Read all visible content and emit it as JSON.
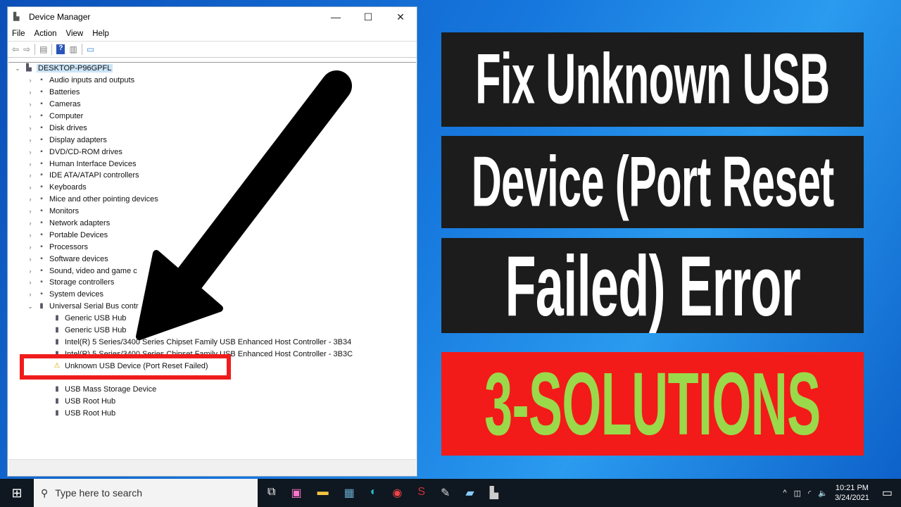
{
  "window": {
    "title": "Device Manager",
    "minimize": "—",
    "maximize": "☐",
    "close": "✕"
  },
  "menu": [
    "File",
    "Action",
    "View",
    "Help"
  ],
  "tree": {
    "root": "DESKTOP-P96GPFL",
    "categories": [
      "Audio inputs and outputs",
      "Batteries",
      "Cameras",
      "Computer",
      "Disk drives",
      "Display adapters",
      "DVD/CD-ROM drives",
      "Human Interface Devices",
      "IDE ATA/ATAPI controllers",
      "Keyboards",
      "Mice and other pointing devices",
      "Monitors",
      "Network adapters",
      "Portable Devices",
      "Processors",
      "Software devices",
      "Sound, video and game c",
      "Storage controllers",
      "System devices"
    ],
    "expanded": "Universal Serial Bus contr",
    "usb_children": [
      "Generic USB Hub",
      "Generic USB Hub",
      "Intel(R) 5 Series/3400 Series Chipset Family USB Enhanced Host Controller - 3B34",
      "Intel(R) 5 Series/3400 Series Chipset Family USB Enhanced Host Controller - 3B3C",
      "Unknown USB Device (Port Reset Failed)",
      "",
      "USB Mass Storage Device",
      "USB Root Hub",
      "USB Root Hub"
    ]
  },
  "headline": {
    "line1": "Fix Unknown USB",
    "line2": "Device (Port Reset",
    "line3": "Failed) Error",
    "line4": "3-SOLUTIONS"
  },
  "colors": {
    "highlight_red": "#f31a1a",
    "solutions_green": "#9ad94a",
    "panel_black": "#1c1c1c"
  },
  "taskbar": {
    "search_placeholder": "Type here to search",
    "time": "10:21 PM",
    "date": "3/24/2021"
  }
}
